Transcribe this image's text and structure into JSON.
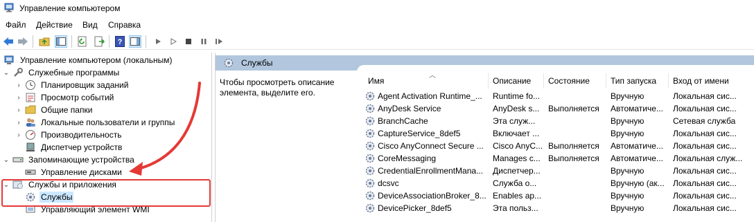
{
  "window": {
    "title": "Управление компьютером"
  },
  "menu": [
    "Файл",
    "Действие",
    "Вид",
    "Справка"
  ],
  "tree": [
    {
      "label": "Управление компьютером (локальным)",
      "level": 0,
      "chev": "",
      "icon": "computer-management-icon"
    },
    {
      "label": "Служебные программы",
      "level": 1,
      "chev": "v",
      "icon": "tools-icon"
    },
    {
      "label": "Планировщик заданий",
      "level": 2,
      "chev": ">",
      "icon": "clock-icon"
    },
    {
      "label": "Просмотр событий",
      "level": 2,
      "chev": ">",
      "icon": "event-viewer-icon"
    },
    {
      "label": "Общие папки",
      "level": 2,
      "chev": ">",
      "icon": "shared-folder-icon"
    },
    {
      "label": "Локальные пользователи и группы",
      "level": 2,
      "chev": ">",
      "icon": "users-icon"
    },
    {
      "label": "Производительность",
      "level": 2,
      "chev": ">",
      "icon": "performance-icon"
    },
    {
      "label": "Диспетчер устройств",
      "level": 2,
      "chev": "",
      "icon": "device-manager-icon"
    },
    {
      "label": "Запоминающие устройства",
      "level": 1,
      "chev": "v",
      "icon": "storage-icon"
    },
    {
      "label": "Управление дисками",
      "level": 2,
      "chev": "",
      "icon": "disk-icon"
    },
    {
      "label": "Службы и приложения",
      "level": 1,
      "chev": "v",
      "icon": "services-apps-icon"
    },
    {
      "label": "Службы",
      "level": 2,
      "chev": "",
      "icon": "gear-icon",
      "selected": true
    },
    {
      "label": "Управляющий элемент WMI",
      "level": 2,
      "chev": "",
      "icon": "wmi-icon"
    }
  ],
  "panel": {
    "title": "Службы",
    "description": "Чтобы просмотреть описание элемента, выделите его."
  },
  "columns": [
    "Имя",
    "Описание",
    "Состояние",
    "Тип запуска",
    "Вход от имени"
  ],
  "services": [
    [
      "Agent Activation Runtime_...",
      "Runtime fo...",
      "",
      "Вручную",
      "Локальная сис..."
    ],
    [
      "AnyDesk Service",
      "AnyDesk s...",
      "Выполняется",
      "Автоматиче...",
      "Локальная сис..."
    ],
    [
      "BranchCache",
      "Эта служ...",
      "",
      "Вручную",
      "Сетевая служба"
    ],
    [
      "CaptureService_8def5",
      "Включает ...",
      "",
      "Вручную",
      "Локальная сис..."
    ],
    [
      "Cisco AnyConnect Secure ...",
      "Cisco AnyC...",
      "Выполняется",
      "Автоматиче...",
      "Локальная сис..."
    ],
    [
      "CoreMessaging",
      "Manages c...",
      "Выполняется",
      "Автоматиче...",
      "Локальная служ..."
    ],
    [
      "CredentialEnrollmentMana...",
      "Диспетчер...",
      "",
      "Вручную",
      "Локальная сис..."
    ],
    [
      "dcsvc",
      "Служба о...",
      "",
      "Вручную (ак...",
      "Локальная сис..."
    ],
    [
      "DeviceAssociationBroker_8...",
      "Enables ap...",
      "",
      "Вручную",
      "Локальная сис..."
    ],
    [
      "DevicePicker_8def5",
      "Эта польз...",
      "",
      "Вручную",
      "Локальная сис..."
    ]
  ],
  "colors": {
    "header_band": "#b2c7de",
    "selection": "#cce8ff",
    "highlight": "#e53935"
  }
}
